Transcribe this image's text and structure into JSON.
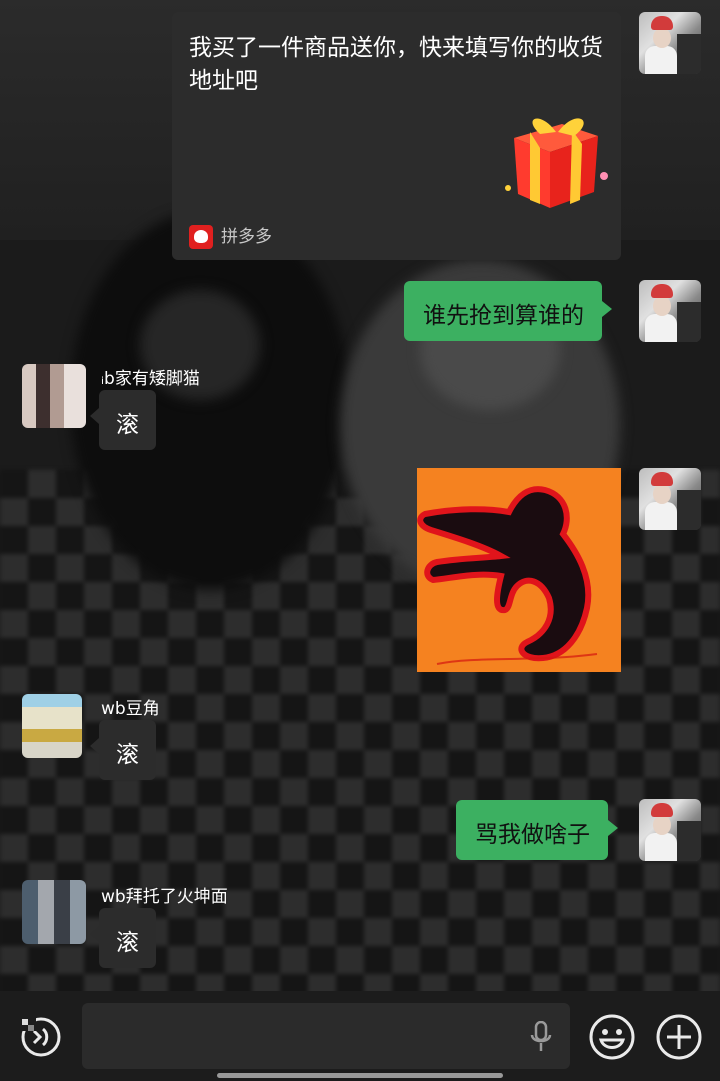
{
  "messages": {
    "card": {
      "text": "我买了一件商品送你，快来填写你的收货地址吧",
      "source": "拼多多"
    },
    "self1": {
      "text": "谁先抢到算谁的"
    },
    "other1": {
      "name": "ᵢb家有矮脚猫",
      "text": "滚"
    },
    "other2": {
      "name": "wb豆角",
      "text": "滚"
    },
    "self2": {
      "text": "骂我做啥子"
    },
    "other3": {
      "name": "wb拜托了火坤面",
      "text": "滚"
    }
  },
  "colors": {
    "green_bubble": "#3cb061",
    "dark_bubble": "#2c2c2c",
    "sticker_bg": "#f58220",
    "brand_pdd": "#e0201f"
  },
  "icons": {
    "input_left": "voice-mode-icon",
    "input_mic": "microphone-icon",
    "emoji": "smiley-emoji-icon",
    "plus": "plus-circle-icon"
  }
}
